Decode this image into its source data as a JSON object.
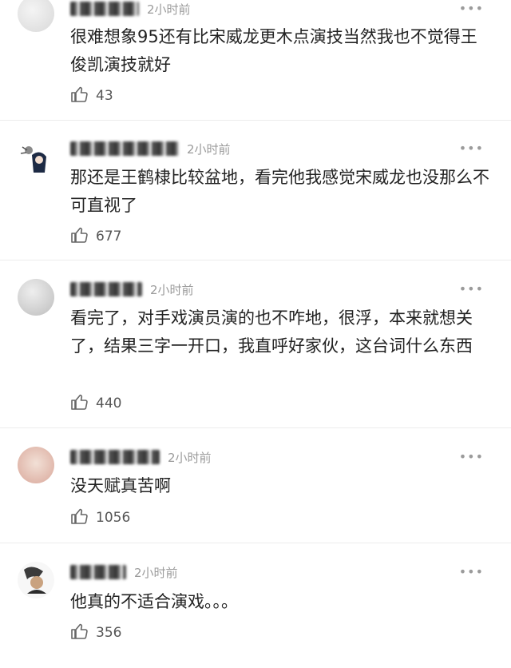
{
  "comments": [
    {
      "time": "2小时前",
      "text": "很难想象95还有比宋威龙更木点演技当然我也不觉得王俊凯演技就好",
      "likes": "43",
      "more": "•••"
    },
    {
      "time": "2小时前",
      "text": "那还是王鹤棣比较盆地，看完他我感觉宋威龙也没那么不可直视了",
      "likes": "677",
      "more": "•••"
    },
    {
      "time": "2小时前",
      "text": "看完了，对手戏演员演的也不咋地，很浮，本来就想关了，结果三字一开口，我直呼好家伙，这台词什么东西",
      "likes": "440",
      "more": "•••"
    },
    {
      "time": "2小时前",
      "text": "没天赋真苦啊",
      "likes": "1056",
      "more": "•••"
    },
    {
      "time": "2小时前",
      "text": "他真的不适合演戏。。。",
      "likes": "356",
      "more": "•••"
    }
  ],
  "icons": {
    "avatar": "avatar",
    "like": "thumbs-up-icon",
    "more": "more-dots-icon"
  }
}
